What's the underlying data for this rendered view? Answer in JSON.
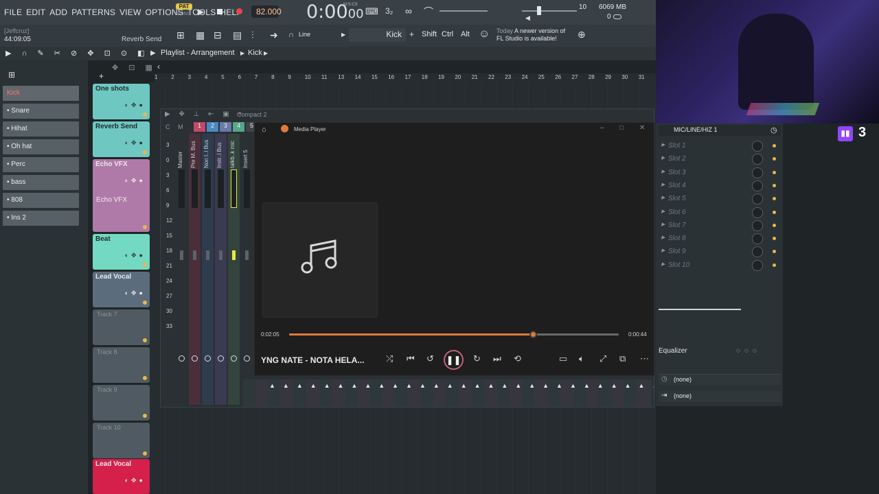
{
  "menu": {
    "items": [
      "FILE",
      "EDIT",
      "ADD",
      "PATTERNS",
      "VIEW",
      "OPTIONS",
      "TOOLS",
      "HELP"
    ]
  },
  "transport": {
    "pat_label": "PAT",
    "song_label": "SONG",
    "tempo": "82.000",
    "time": "0:00",
    "time_sub": "00",
    "time_unit": "M:S:CS",
    "cpu_label": "10",
    "mem": "6069 MB",
    "voices": "0"
  },
  "hint": {
    "user": "[Jeffcruz]",
    "clock": "44:09:05",
    "target": "Reverb Send"
  },
  "toolbar": {
    "snap": "Line",
    "pattern": "Kick",
    "shift": "Shift",
    "ctrl": "Ctrl",
    "alt": "Alt",
    "news_day": "Today",
    "news_text": "A newer version of FL Studio is available!"
  },
  "playlist": {
    "title": "Playlist - Arrangement",
    "pattern": "Kick"
  },
  "ruler": [
    "1",
    "2",
    "3",
    "4",
    "5",
    "6",
    "7",
    "8",
    "9",
    "10",
    "11",
    "13",
    "14",
    "15",
    "16",
    "17",
    "18",
    "19",
    "20",
    "21",
    "22",
    "23",
    "24",
    "25",
    "26",
    "27",
    "28",
    "29",
    "30",
    "31"
  ],
  "browser": {
    "items": [
      "Kick",
      "Snare",
      "Hihat",
      "Oh hat",
      "Perc",
      "bass",
      "808",
      "Ins 2"
    ]
  },
  "tracks": [
    {
      "name": "One shots"
    },
    {
      "name": "Reverb Send"
    },
    {
      "name": "Echo VFX",
      "clip": "Echo VFX"
    },
    {
      "name": "Beat"
    },
    {
      "name": "Lead Vocal"
    },
    {
      "name": "Track 7"
    },
    {
      "name": "Track 8"
    },
    {
      "name": "Track 9"
    },
    {
      "name": "Track 10"
    },
    {
      "name": "Lead Vocal"
    }
  ],
  "mixer": {
    "title": "Compact 2",
    "db_scale": [
      "3",
      "0",
      "3",
      "6",
      "9",
      "12",
      "15",
      "18",
      "21",
      "24",
      "27",
      "30",
      "33"
    ],
    "headers": {
      "c": "C",
      "m": "M"
    },
    "numbers": [
      "1",
      "2",
      "3",
      "4",
      "5"
    ],
    "channels": [
      "Master",
      "Pre M. Bus",
      "Non I..l Bus",
      "Instr..l Bus",
      "talkb..k mic",
      "Insert 5"
    ]
  },
  "media_player": {
    "title": "Media Player",
    "elapsed": "0:02:05",
    "remaining": "0:00:44",
    "progress": 0.74,
    "track_title": "YNG NATE - NOTA HELA...",
    "accent": "#e07a3a"
  },
  "fx": {
    "input": "MIC/LINE/HIZ 1",
    "slots": [
      "Slot 1",
      "Slot 2",
      "Slot 3",
      "Slot 4",
      "Slot 5",
      "Slot 6",
      "Slot 7",
      "Slot 8",
      "Slot 9",
      "Slot 10"
    ],
    "equalizer": "Equalizer",
    "send1": "(none)",
    "send2": "(none)"
  },
  "twitch": {
    "count": "3"
  }
}
